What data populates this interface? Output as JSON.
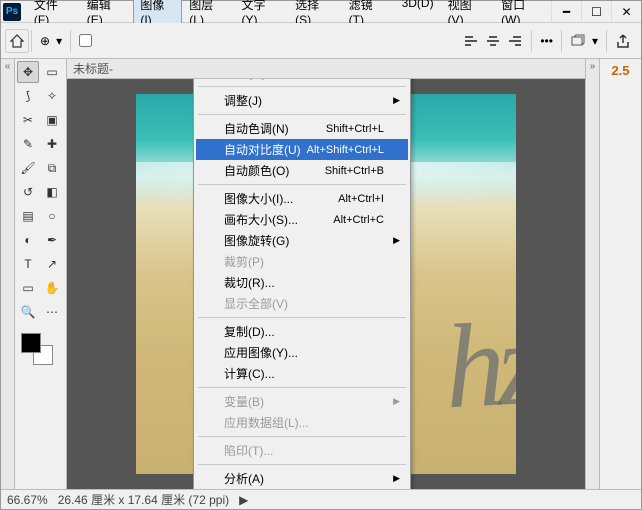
{
  "logo": "Ps",
  "menubar": {
    "items": [
      "文件(F)",
      "编辑(E)",
      "图像(I)",
      "图层(L)",
      "文字(Y)",
      "选择(S)",
      "滤镜(T)",
      "3D(D)",
      "视图(V)",
      "窗口(W)"
    ],
    "active_index": 2
  },
  "window_controls": {
    "minimize": "━",
    "maximize": "☐",
    "close": "✕"
  },
  "options_bar": {
    "left_collapse": "«",
    "move_opts": "⊕",
    "dropdown_caret": "▾"
  },
  "left_rail": "«",
  "right_rail": "»",
  "document_tab": "未标题-",
  "canvas_text": "hz",
  "right_panel": {
    "value": "2.5"
  },
  "statusbar": {
    "zoom": "66.67%",
    "info": "26.46 厘米 x 17.64 厘米 (72 ppi)",
    "caret": "▶"
  },
  "image_menu": {
    "items": [
      {
        "label": "模式(M)",
        "submenu": true
      },
      {
        "sep": true
      },
      {
        "label": "调整(J)",
        "submenu": true
      },
      {
        "sep": true
      },
      {
        "label": "自动色调(N)",
        "shortcut": "Shift+Ctrl+L"
      },
      {
        "label": "自动对比度(U)",
        "shortcut": "Alt+Shift+Ctrl+L",
        "highlight": true
      },
      {
        "label": "自动颜色(O)",
        "shortcut": "Shift+Ctrl+B"
      },
      {
        "sep": true
      },
      {
        "label": "图像大小(I)...",
        "shortcut": "Alt+Ctrl+I"
      },
      {
        "label": "画布大小(S)...",
        "shortcut": "Alt+Ctrl+C"
      },
      {
        "label": "图像旋转(G)",
        "submenu": true
      },
      {
        "label": "裁剪(P)",
        "disabled": true
      },
      {
        "label": "裁切(R)..."
      },
      {
        "label": "显示全部(V)",
        "disabled": true
      },
      {
        "sep": true
      },
      {
        "label": "复制(D)..."
      },
      {
        "label": "应用图像(Y)..."
      },
      {
        "label": "计算(C)..."
      },
      {
        "sep": true
      },
      {
        "label": "变量(B)",
        "submenu": true,
        "disabled": true
      },
      {
        "label": "应用数据组(L)...",
        "disabled": true
      },
      {
        "sep": true
      },
      {
        "label": "陷印(T)...",
        "disabled": true
      },
      {
        "sep": true
      },
      {
        "label": "分析(A)",
        "submenu": true
      }
    ]
  },
  "tools": [
    "move",
    "marquee",
    "lasso",
    "wand",
    "crop",
    "frame",
    "eyedropper",
    "heal",
    "brush",
    "stamp",
    "history",
    "eraser",
    "gradient",
    "blur",
    "dodge",
    "pen",
    "type",
    "path",
    "rect",
    "hand",
    "zoom",
    "ellipsis"
  ]
}
